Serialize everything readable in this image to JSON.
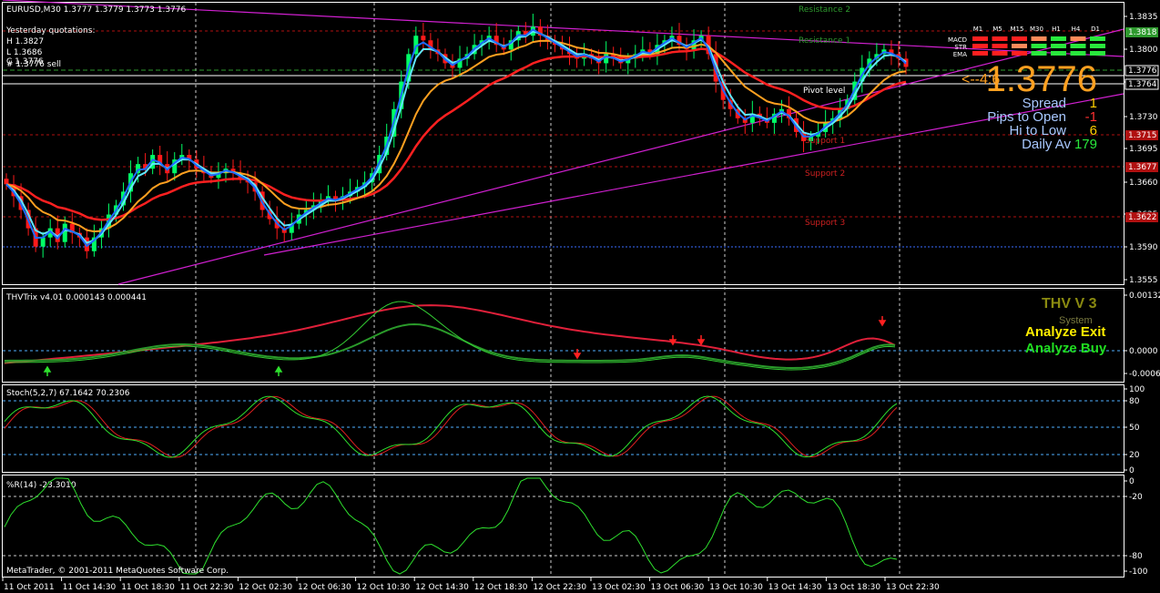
{
  "header": {
    "symbol_line": "EURUSD,M30  1.3777 1.3779 1.3773 1.3776",
    "yesterday_title": "Yesterday quotations:",
    "yesterday_high": "H 1.3827",
    "yesterday_low": "L 1.3686",
    "yesterday_close": "C 1.3776",
    "signal_text": "# 1.3776 sell"
  },
  "levels": {
    "resistance2": "Resistance 2",
    "resistance1": "Resistance 1",
    "pivot": "Pivot level",
    "support1": "Support 1",
    "support2": "Support 2",
    "support3": "Support 3"
  },
  "price_box": {
    "price": "1.3776",
    "arrow_text": "<--4:6",
    "spread_label": "Spread",
    "spread_value": "1",
    "pips_label": "Pips to Open",
    "pips_value": "-1",
    "hilo_label": "Hi to Low",
    "hilo_value": "6",
    "daily_label": "Daily Av",
    "daily_value": "179"
  },
  "signal_table": {
    "columns": [
      "M1",
      "M5",
      "M15",
      "M30",
      "H1",
      "H4",
      "D1"
    ],
    "rows": [
      {
        "name": "MACD",
        "colors": [
          "#ff2020",
          "#ff2020",
          "#ff2020",
          "#ff8a5a",
          "#29e83c",
          "#ff8a5a",
          "#29e83c"
        ]
      },
      {
        "name": "STR",
        "colors": [
          "#ff2020",
          "#ff2020",
          "#ff8a5a",
          "#29e83c",
          "#29e83c",
          "#29e83c",
          "#29e83c"
        ]
      },
      {
        "name": "EMA",
        "colors": [
          "#ff2020",
          "#ff2020",
          "#ff2020",
          "#29e83c",
          "#29e83c",
          "#29e83c",
          "#29e83c"
        ]
      }
    ]
  },
  "price_axis": {
    "ticks": [
      "1.3835",
      "1.3800",
      "1.3764",
      "1.3730",
      "1.3695",
      "1.3660",
      "1.3625",
      "1.3590",
      "1.3555"
    ],
    "tags": [
      {
        "text": "1.3818",
        "color": "#2e9a2e"
      },
      {
        "text": "1.3776",
        "color": "#ffffff"
      },
      {
        "text": "1.3764",
        "color": "#ffffff"
      },
      {
        "text": "1.3715",
        "color": "#b01010"
      },
      {
        "text": "1.3677",
        "color": "#b01010"
      },
      {
        "text": "1.3622",
        "color": "#b01010"
      }
    ]
  },
  "thv_panel": {
    "title": "THVTrix v4.01 0.000143 0.000441",
    "ticks": [
      "0.00132",
      "0.0000",
      "-0.00060"
    ],
    "brand": "THV V 3",
    "system": "System",
    "exit_label": "Analyze Exit",
    "buy_label": "Analyze Buy"
  },
  "stoch_panel": {
    "title": "Stoch(5,2,7) 67.1642 70.2306",
    "ticks": [
      "100",
      "80",
      "50",
      "20",
      "0"
    ]
  },
  "wpr_panel": {
    "title": "%R(14) -23.3010",
    "ticks": [
      "0",
      "-20",
      "-80",
      "-100"
    ],
    "copyright": "MetaTrader, © 2001-2011 MetaQuotes Software Corp."
  },
  "time_axis": [
    "11 Oct 2011",
    "11 Oct 14:30",
    "11 Oct 18:30",
    "11 Oct 22:30",
    "12 Oct 02:30",
    "12 Oct 06:30",
    "12 Oct 10:30",
    "12 Oct 14:30",
    "12 Oct 18:30",
    "12 Oct 22:30",
    "13 Oct 02:30",
    "13 Oct 06:30",
    "13 Oct 10:30",
    "13 Oct 14:30",
    "13 Oct 18:30",
    "13 Oct 22:30"
  ],
  "colors": {
    "bull": "#00ff66",
    "bear": "#ff1a1a",
    "ema_fast": "#1e6bff",
    "ema_fast2": "#5fe8ff",
    "ema_mid": "#ffa020",
    "ema_slow": "#ff2020",
    "trend": "#d020d0"
  },
  "chart_data": {
    "type": "candlestick",
    "title": "EURUSD,M30",
    "ylim": [
      1.354,
      1.3845
    ],
    "close": [
      1.3648,
      1.3635,
      1.362,
      1.36,
      1.358,
      1.359,
      1.36,
      1.3585,
      1.3605,
      1.3595,
      1.359,
      1.3575,
      1.359,
      1.36,
      1.3615,
      1.3625,
      1.364,
      1.366,
      1.367,
      1.3665,
      1.368,
      1.367,
      1.366,
      1.3675,
      1.368,
      1.3675,
      1.3665,
      1.366,
      1.3655,
      1.366,
      1.3665,
      1.366,
      1.3655,
      1.365,
      1.364,
      1.362,
      1.361,
      1.36,
      1.3595,
      1.3605,
      1.3615,
      1.362,
      1.3625,
      1.363,
      1.3635,
      1.363,
      1.3635,
      1.364,
      1.3645,
      1.365,
      1.366,
      1.368,
      1.37,
      1.373,
      1.376,
      1.379,
      1.381,
      1.3805,
      1.3795,
      1.379,
      1.378,
      1.3775,
      1.3785,
      1.379,
      1.38,
      1.3805,
      1.381,
      1.38,
      1.3795,
      1.3805,
      1.3815,
      1.381,
      1.382,
      1.381,
      1.3805,
      1.38,
      1.3795,
      1.379,
      1.3785,
      1.379,
      1.3785,
      1.378,
      1.379,
      1.3785,
      1.378,
      1.3785,
      1.379,
      1.3795,
      1.379,
      1.38,
      1.3805,
      1.381,
      1.38,
      1.3795,
      1.3805,
      1.381,
      1.379,
      1.376,
      1.374,
      1.373,
      1.372,
      1.3715,
      1.3725,
      1.372,
      1.3715,
      1.3725,
      1.373,
      1.372,
      1.3705,
      1.3695,
      1.37,
      1.3705,
      1.3715,
      1.372,
      1.373,
      1.374,
      1.376,
      1.3775,
      1.3785,
      1.379,
      1.3795,
      1.379,
      1.3785,
      1.3776
    ]
  }
}
